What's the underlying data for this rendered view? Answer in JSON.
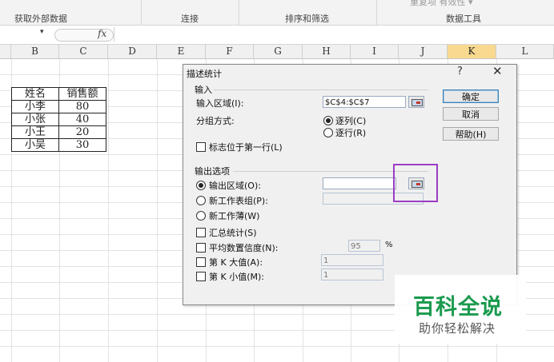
{
  "ribbon": {
    "top_text": "重复项 有效性 ▾",
    "groups": [
      "获取外部数据",
      "连接",
      "排序和筛选",
      "数据工具"
    ]
  },
  "formula_bar": {
    "fx_label": "fx",
    "dropdown_glyph": "▾"
  },
  "columns": [
    "B",
    "C",
    "D",
    "E",
    "F",
    "G",
    "H",
    "I",
    "J",
    "K",
    "L"
  ],
  "selected_column": "K",
  "sheet_table": {
    "headers": [
      "姓名",
      "销售额"
    ],
    "rows": [
      [
        "小李",
        "80"
      ],
      [
        "小张",
        "40"
      ],
      [
        "小王",
        "20"
      ],
      [
        "小吴",
        "30"
      ]
    ]
  },
  "dialog": {
    "title": "描述统计",
    "help_glyph": "?",
    "close_glyph": "✕",
    "input_group": "输入",
    "input_range_label": "输入区域(I):",
    "input_range_value": "$C$4:$C$7",
    "group_by_label": "分组方式:",
    "by_column": "逐列(C)",
    "by_row": "逐行(R)",
    "labels_first_row": "标志位于第一行(L)",
    "output_group": "输出选项",
    "output_range": "输出区域(O):",
    "output_range_value": "",
    "new_worksheet": "新工作表组(P):",
    "new_workbook": "新工作薄(W)",
    "summary_stats": "汇总统计(S)",
    "confidence_level": "平均数置信度(N):",
    "confidence_value": "95",
    "percent_sign": "%",
    "kth_largest": "第 K 大值(A):",
    "kth_largest_value": "1",
    "kth_smallest": "第 K 小值(M):",
    "kth_smallest_value": "1",
    "ok_button": "确定",
    "cancel_button": "取消",
    "help_button": "帮助(H)"
  },
  "watermark": {
    "title": "百科全说",
    "subtitle": "助你轻松解决"
  },
  "colors": {
    "highlight": "#9b3cc4",
    "selected_column": "#f8d98f",
    "watermark_green": "#1a9a4e"
  }
}
